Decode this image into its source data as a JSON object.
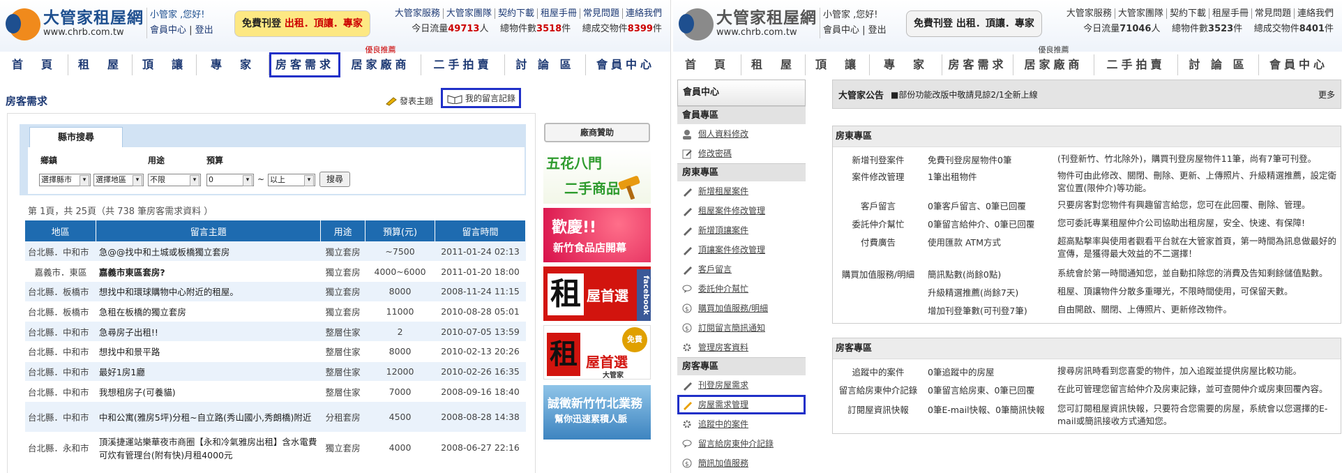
{
  "site": {
    "name": "大管家租屋網",
    "url": "www.chrb.com.tw"
  },
  "left": {
    "user": {
      "greet": "小管家 ,您好!",
      "center": "會員中心",
      "logout": "登出"
    },
    "free": {
      "prefix": "免費刊登",
      "rest": "出租．頂讓．專家"
    },
    "toplinks": [
      "大管家服務",
      "大管家團隊",
      "契約下載",
      "租屋手冊",
      "常見問題",
      "連絡我們"
    ],
    "stats": {
      "traffic_label": "今日流量",
      "traffic": "49713",
      "traffic_unit": "人",
      "items_label": "總物件數",
      "items": "3518",
      "items_unit": "件",
      "deals_label": "總成交物件",
      "deals": "8399",
      "deals_unit": "件"
    },
    "nav": [
      "首　頁",
      "租　屋",
      "頂　讓",
      "專　家",
      "房客需求",
      "居家廠商",
      "二手拍賣",
      "討 論 區",
      "會員中心"
    ],
    "nav_tag": "優良推薦",
    "page_title": "房客需求",
    "post_link": "發表主題",
    "my_msgs": "我的留言記錄",
    "search": {
      "tab": "縣市搜尋",
      "label_area": "鄉鎮",
      "label_use": "用途",
      "label_budget": "預算",
      "city": "選擇縣市",
      "district": "選擇地區",
      "use": "不限",
      "budget_from": "0",
      "tilde": "~",
      "budget_to": "以上",
      "button": "搜尋"
    },
    "page_info": "第 1頁，共 25頁（共 738 筆房客需求資料 ）",
    "table": {
      "headers": [
        "地區",
        "留言主題",
        "用途",
        "預算(元)",
        "留言時間"
      ],
      "rows": [
        [
          "台北縣．中和市",
          "急@@找中和土城或板橋獨立套房",
          "獨立套房",
          "~7500",
          "2011-01-24 02:13"
        ],
        [
          "嘉義市．東區",
          "嘉義市東區套房?",
          "獨立套房",
          "4000~6000",
          "2011-01-20 18:00"
        ],
        [
          "台北縣．板橋市",
          "想找中和環球購物中心附近的租屋。",
          "獨立套房",
          "8000",
          "2008-11-24 11:15"
        ],
        [
          "台北縣．板橋市",
          "急租在板橋的獨立套房",
          "獨立套房",
          "11000",
          "2010-08-28 05:01"
        ],
        [
          "台北縣．中和市",
          "急尋房子出租!!",
          "整層住家",
          "2",
          "2010-07-05 13:59"
        ],
        [
          "台北縣．中和市",
          "想找中和景平路",
          "整層住家",
          "8000",
          "2010-02-13 20:26"
        ],
        [
          "台北縣．中和市",
          "最好1房1廳",
          "整層住家",
          "12000",
          "2010-02-26 16:35"
        ],
        [
          "台北縣．中和市",
          "我想租房子(可養貓)",
          "整層住家",
          "7000",
          "2008-09-16 18:40"
        ],
        [
          "台北縣．中和市",
          "中和公寓(雅房5坪)分租~自立路(秀山國小,秀朗橋)附近",
          "分租套房",
          "4500",
          "2008-08-28 14:38"
        ],
        [
          "台北縣．永和市",
          "頂溪捷運站樂華夜市商圈【永和冷氣雅房出租】含水電費可炊有管理台(附有快)月租4000元",
          "獨立套房",
          "4000",
          "2008-06-27 22:16"
        ]
      ]
    },
    "sponsor": {
      "title": "廠商贊助",
      "ads": [
        "五花八門",
        "二手商品",
        "歡慶!!",
        "新竹食品店開幕",
        "租",
        "屋首選",
        "facebook",
        "免費",
        "屋首選",
        "大管家",
        "誠徵新竹竹北業務",
        "幫你迅速累積人脈"
      ]
    }
  },
  "right": {
    "user": {
      "greet": "小管家 ,您好!",
      "center": "會員中心",
      "logout": "登出"
    },
    "free": {
      "prefix": "免費刊登",
      "rest": "出租．頂讓．專家"
    },
    "toplinks": [
      "大管家服務",
      "大管家團隊",
      "契約下載",
      "租屋手冊",
      "常見問題",
      "連絡我們"
    ],
    "stats": {
      "traffic_label": "今日流量",
      "traffic": "71046",
      "traffic_unit": "人",
      "items_label": "總物件數",
      "items": "3523",
      "items_unit": "件",
      "deals_label": "總成交物件",
      "deals": "8401",
      "deals_unit": "件"
    },
    "nav": [
      "首　頁",
      "租　屋",
      "頂　讓",
      "專　家",
      "房客需求",
      "居家廠商",
      "二手拍賣",
      "討 論 區",
      "會員中心"
    ],
    "nav_tag": "優良推薦",
    "sidebar": {
      "top": "會員中心",
      "sec_member": "會員專區",
      "member_items": [
        "個人資料修改",
        "修改密碼"
      ],
      "sec_landlord": "房東專區",
      "landlord_items": [
        "新增租屋案件",
        "租屋案件修改管理",
        "新增頂讓案件",
        "頂讓案件修改管理",
        "客戶留言",
        "委託仲介幫忙",
        "購買加值服務/明細",
        "訂閱留言簡訊通知",
        "管理房客資料"
      ],
      "sec_tenant": "房客專區",
      "tenant_items": [
        "刊登房屋需求",
        "房屋需求管理",
        "追蹤中的案件",
        "留言給房東仲介記錄",
        "簡訊加值服務"
      ]
    },
    "announce": {
      "title": "大管家公告",
      "msg": "■部份功能改版中敬請見諒2/1全新上線",
      "more": "更多"
    },
    "landlord": {
      "title": "房東專區",
      "rows": [
        {
          "k": "新增刊登案件",
          "v": "免費刊登房屋物件0筆",
          "d": "(刊登新竹、竹北除外)，購買刊登房屋物件11筆，尚有7筆可刊登。"
        },
        {
          "k": "案件修改管理",
          "v": "1筆出租物件",
          "d": "物件可由此修改、關閉、刪除、更新、上傳照片、升級精選推薦，設定衛宮位置(限仲介)等功能。"
        },
        {
          "k": "客戶留言",
          "v": "0筆客戶留言、0筆已回覆",
          "d": "只要房客對您物件有興趣留言給您，您可在此回覆、刪除、管理。"
        },
        {
          "k": "委託仲介幫忙",
          "v": "0筆留言給仲介、0筆已回覆",
          "d": "您可委託專業租屋仲介公司協助出租房屋，安全、快速、有保障!"
        },
        {
          "k": "付費廣告",
          "v": "使用匯款 ATM方式",
          "d": "超高點擊率與使用者觀看平台就在大管家首頁，第一時間為訊息做最好的宣傳，是獲得最大效益的不二選擇！"
        },
        {
          "k": "購買加值服務/明細",
          "v": "簡訊點數(尚餘0點)",
          "d": "系統會於第一時間通知您，並自動扣除您的消費及告知剩餘儲值點數。"
        },
        {
          "k": "",
          "v": "升級精選推薦(尚餘7天)",
          "d": "租屋、頂讓物件分散多重曝光，不限時間使用，可保留天數。"
        },
        {
          "k": "",
          "v": "增加刊登筆數(可刊登7筆)",
          "d": "自由開啟、關閉、上傳照片、更新修改物件。"
        }
      ]
    },
    "tenant": {
      "title": "房客專區",
      "rows": [
        {
          "k": "追蹤中的案件",
          "v": "0筆追蹤中的房屋",
          "d": "搜尋房訊時看到您喜愛的物件，加入追蹤並提供房屋比較功能。"
        },
        {
          "k": "留言給房東仲介記錄",
          "v": "0筆留言給房東、0筆已回覆",
          "d": "在此可管理您留言給仲介及房東記錄，並可查閱仲介或房東回覆內容。"
        },
        {
          "k": "訂閱屋資訊快報",
          "v": "0筆E-mail快報、0筆簡訊快報",
          "d": "您可訂閱租屋資訊快報，只要符合您需要的房屋，系統會以您選擇的E-mail或簡訊接收方式通知您。"
        }
      ]
    }
  }
}
